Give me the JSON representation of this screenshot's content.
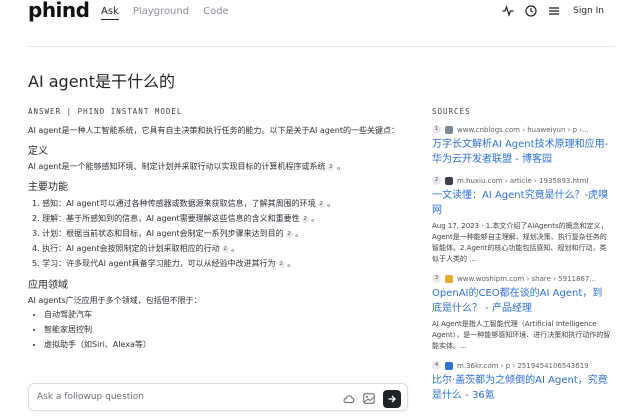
{
  "brand": "phind",
  "nav": {
    "ask": "Ask",
    "playground": "Playground",
    "code": "Code"
  },
  "header": {
    "signin": "Sign In",
    "icons": [
      "activity-icon",
      "clock-icon",
      "menu-icon"
    ]
  },
  "question": "AI agent是干什么的",
  "answer": {
    "label": "ANSWER | PHIND INSTANT MODEL",
    "intro": "AI agent是一种人工智能系统，它具有自主决策和执行任务的能力。以下是关于AI agent的一些关键点：",
    "h_def": "定义",
    "def_text": "AI agent是一个能够感知环境、制定计划并采取行动以实现目标的计算机程序或系统",
    "h_func": "主要功能",
    "functions": [
      {
        "text": "1. 感知：AI agent可以通过各种传感器或数据源来获取信息，了解其周围的环境",
        "cite": "2"
      },
      {
        "text": "2. 理解：基于所感知到的信息，AI agent需要理解这些信息的含义和重要性",
        "cite": "2"
      },
      {
        "text": "3. 计划：根据当前状态和目标，AI agent会制定一系列步骤来达到目的",
        "cite": "2"
      },
      {
        "text": "4. 执行：AI agent会按照制定的计划采取相应的行动",
        "cite": "2"
      },
      {
        "text": "5. 学习：许多现代AI agent具备学习能力，可以从经验中改进其行为",
        "cite": "2"
      }
    ],
    "def_cite": "2",
    "h_apps": "应用领域",
    "apps_intro": "AI agents广泛应用于多个领域，包括但不限于：",
    "apps": [
      "自动驾驶汽车",
      "智能家居控制",
      "虚拟助手（如Siri、Alexa等）"
    ]
  },
  "sources": {
    "label": "SOURCES",
    "items": [
      {
        "num": "1",
        "domain": "www.cnblogs.com › huaweiyun › p ›...",
        "title": "万字长文解析AI Agent技术原理和应用- 华为云开发者联盟 - 博客园",
        "snippet": "",
        "favicon_color": "#7a8b99"
      },
      {
        "num": "2",
        "domain": "m.huxiu.com › article › 1935893.html",
        "title": "一文读懂：AI Agent究竟是什么？-虎嗅网",
        "snippet": "Aug 17, 2023 · 1.本文介绍了AIAgents的概念和定义，Agent是一种能够自主理解、规划决策、执行复杂任务的智能体。2.Agent的核心功能包括感知、规划和行动，类似于人类的 ...",
        "favicon_color": "#3c4048"
      },
      {
        "num": "3",
        "domain": "www.woshipm.com › share › 5911867...",
        "title": "OpenAI的CEO都在谈的AI Agent，到底是什么？ - 产品经理",
        "snippet": "AI Agent是指人工智能代理（Artificial Intelligence Agent），是一种能够感知环境、进行决策和执行动作的智能实体。...",
        "favicon_color": "#e5a92b"
      },
      {
        "num": "4",
        "domain": "m.36kr.com › p › 2519454106543619",
        "title": "比尔·盖茨都为之倾倒的AI Agent，究竟是什么 - 36氪",
        "snippet": "",
        "favicon_color": "#2f6fd6"
      }
    ]
  },
  "followup": {
    "placeholder": "Ask a followup question"
  }
}
